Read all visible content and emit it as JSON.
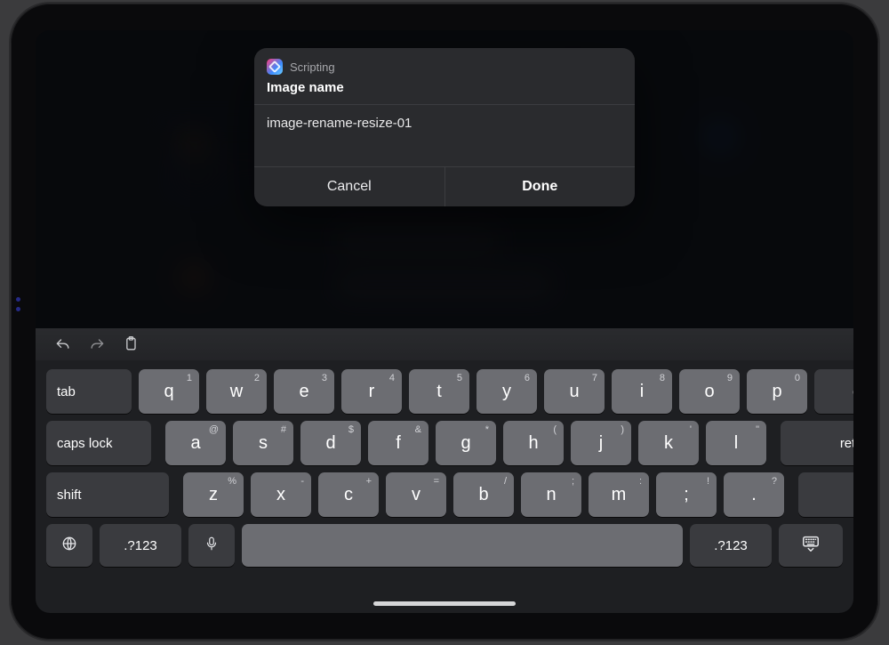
{
  "prompt": {
    "app": "Scripting",
    "title": "Image name",
    "value": "image-rename-resize-01",
    "cancel": "Cancel",
    "done": "Done"
  },
  "keyboard": {
    "row1_alts": [
      "1",
      "2",
      "3",
      "4",
      "5",
      "6",
      "7",
      "8",
      "9",
      "0"
    ],
    "row1": [
      "q",
      "w",
      "e",
      "r",
      "t",
      "y",
      "u",
      "i",
      "o",
      "p"
    ],
    "row2_alts": [
      "@",
      "#",
      "$",
      "&",
      "*",
      "(",
      ")",
      "'",
      "\""
    ],
    "row2": [
      "a",
      "s",
      "d",
      "f",
      "g",
      "h",
      "j",
      "k",
      "l"
    ],
    "row3_alts": [
      "%",
      "-",
      "+",
      "=",
      "/",
      ";",
      ":",
      "!",
      "?"
    ],
    "row3": [
      "z",
      "x",
      "c",
      "v",
      "b",
      "n",
      "m",
      ";",
      "."
    ],
    "row3_disp": [
      "z",
      "x",
      "c",
      "v",
      "b",
      "n",
      "m",
      ";",
      "."
    ],
    "punct_semi_alt": "!",
    "punct_dot_alt": "?",
    "tab": "tab",
    "delete": "delete",
    "caps": "caps lock",
    "return": "return",
    "shift": "shift",
    "sym": ".?123"
  }
}
